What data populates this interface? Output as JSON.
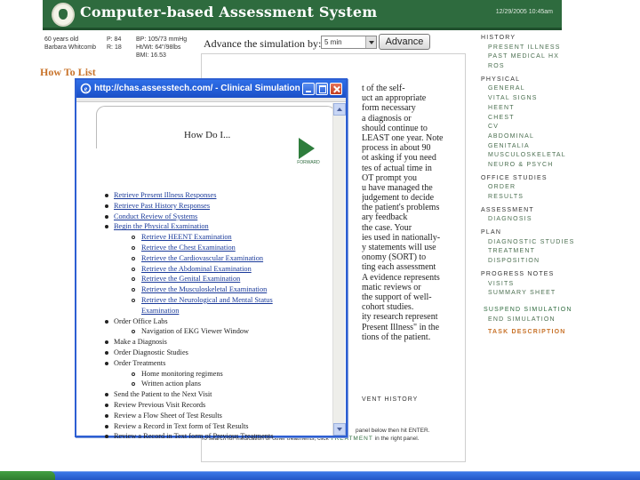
{
  "header": {
    "app_title": "Computer-based Assessment System",
    "date": "12/29/2005 10:45am"
  },
  "patient": {
    "age": "60 years old",
    "name": "Barbara Whitcomb",
    "p": "P:  84",
    "r": "R:  18",
    "bp": "BP:  105/73 mmHg",
    "htwt": "Ht/Wt:  64\"/98lbs",
    "bmi": "BMI:  16.53"
  },
  "advance": {
    "label": "Advance the simulation by:",
    "selected": "5 min",
    "button": "Advance"
  },
  "how_to_list": "How To List",
  "main_text": [
    "t of the self-",
    "uct an appropriate",
    "form necessary",
    "a diagnosis or",
    "should continue to",
    "LEAST one year. Note",
    "process in about 90",
    "ot asking if you need",
    "tes of actual time in",
    "OT prompt you",
    "u have managed the",
    "judgement to decide",
    " the patient's problems",
    "ary feedback",
    "the case. Your",
    "ies used in nationally-",
    "y statements will use",
    "onomy (SORT) to",
    "ting each assessment",
    "A evidence represents",
    "matic reviews or",
    "the support of well-",
    "cohort studies.",
    "ity research represent",
    "Present Illness\" in the",
    "tions of the patient."
  ],
  "previous_history": "VENT HISTORY",
  "bottom_line1": "panel below then hit ENTER.",
  "bottom_line2_pre": "To search for medication or other treatments, click ",
  "bottom_line2_link": "TREATMENT",
  "bottom_line2_post": " in the right panel.",
  "right_nav": {
    "history": "HISTORY",
    "present_illness": "PRESENT ILLNESS",
    "past_medical": "PAST MEDICAL HX",
    "ros": "ROS",
    "physical": "PHYSICAL",
    "general": "GENERAL",
    "vital_signs": "VITAL SIGNS",
    "heent": "HEENT",
    "chest": "CHEST",
    "cv": "CV",
    "abdominal": "ABDOMINAL",
    "genitalia": "GENITALIA",
    "musculoskeletal": "MUSCULOSKELETAL",
    "neuro": "NEURO & PSYCH",
    "office_studies": "OFFICE STUDIES",
    "order": "ORDER",
    "results": "RESULTS",
    "assessment": "ASSESSMENT",
    "diagnosis": "DIAGNOSIS",
    "plan": "PLAN",
    "diagnostic_studies": "DIAGNOSTIC STUDIES",
    "treatment": "TREATMENT",
    "disposition": "DISPOSITION",
    "progress_notes": "PROGRESS NOTES",
    "visits": "VISITS",
    "summary_sheet": "SUMMARY SHEET",
    "suspend": "SUSPEND SIMULATION",
    "end": "END SIMULATION",
    "task_description": "TASK DESCRIPTION"
  },
  "popup": {
    "title": "http://chas.assesstech.com/ - Clinical Simulation: ...",
    "heading": "How Do I...",
    "forward_label": "FORWARD",
    "items": [
      {
        "level": 1,
        "text": "Retrieve Present Illness Responses",
        "link": true
      },
      {
        "level": 1,
        "text": "Retrieve Past History Responses",
        "link": true
      },
      {
        "level": 1,
        "text": "Conduct Review of Systems",
        "link": true
      },
      {
        "level": 1,
        "text": "Begin the Physical Examination",
        "link": true
      },
      {
        "level": 2,
        "text": "Retrieve HEENT Examination",
        "link": true
      },
      {
        "level": 2,
        "text": "Retrieve the Chest Examination",
        "link": true
      },
      {
        "level": 2,
        "text": "Retrieve the Cardiovascular Examination",
        "link": true
      },
      {
        "level": 2,
        "text": "Retrieve the Abdominal Examination",
        "link": true
      },
      {
        "level": 2,
        "text": "Retrieve the Genital Examination",
        "link": true
      },
      {
        "level": 2,
        "text": "Retrieve the Musculoskeletal Examination",
        "link": true
      },
      {
        "level": 2,
        "text": "Retrieve the Neurological and Mental Status",
        "link": true
      },
      {
        "level": 3,
        "text": "Examination",
        "link": true
      },
      {
        "level": 1,
        "text": "Order Office Labs",
        "link": false
      },
      {
        "level": 2,
        "text": "Navigation of EKG Viewer Window",
        "link": false
      },
      {
        "level": 1,
        "text": "Make a Diagnosis",
        "link": false
      },
      {
        "level": 1,
        "text": "Order Diagnostic Studies",
        "link": false
      },
      {
        "level": 1,
        "text": "Order Treatments",
        "link": false
      },
      {
        "level": 2,
        "text": "Home monitoring regimens",
        "link": false
      },
      {
        "level": 2,
        "text": "Written action plans",
        "link": false
      },
      {
        "level": 1,
        "text": "Send the Patient to the Next Visit",
        "link": false
      },
      {
        "level": 1,
        "text": "Review Previous Visit Records",
        "link": false
      },
      {
        "level": 1,
        "text": "Review a Flow Sheet of Test Results",
        "link": false
      },
      {
        "level": 1,
        "text": "Review a Record in Text form of Test Results",
        "link": false
      },
      {
        "level": 1,
        "text": "Review a Record in Text form of Previous Treatments",
        "link": false
      }
    ]
  }
}
